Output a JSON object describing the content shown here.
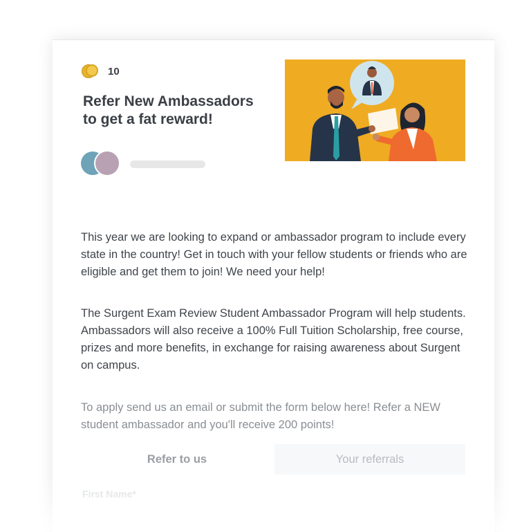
{
  "card": {
    "points": "10",
    "title": "Refer New Ambassadors to get a fat reward!",
    "paragraphs": [
      "This year we are looking to expand or ambassador program to include every state in the country! Get in touch with your fellow students or friends who are eligible and get them to join! We need your help!",
      "The Surgent Exam Review Student Ambassador Program will help students. Ambassadors will also receive a 100% Full Tuition Scholarship, free course, prizes and more benefits, in exchange for raising awareness about Surgent on campus.",
      "To apply send us an email or submit the form below here! Refer a NEW student ambassador and you'll receive 200 points!"
    ],
    "tabs": [
      {
        "label": "Refer to us"
      },
      {
        "label": "Your referrals"
      }
    ],
    "form": {
      "first_name_label": "First Name*"
    }
  },
  "icons": {
    "points": "coin-icon",
    "avatars": [
      "avatar-icon",
      "avatar-icon"
    ],
    "illustration": "referral-illustration"
  },
  "colors": {
    "illustration_bg": "#efab22",
    "title_text": "#3a3f45",
    "body_text": "#3f444a",
    "muted_text": "#8a8e93",
    "coin": "#f2c94c"
  }
}
